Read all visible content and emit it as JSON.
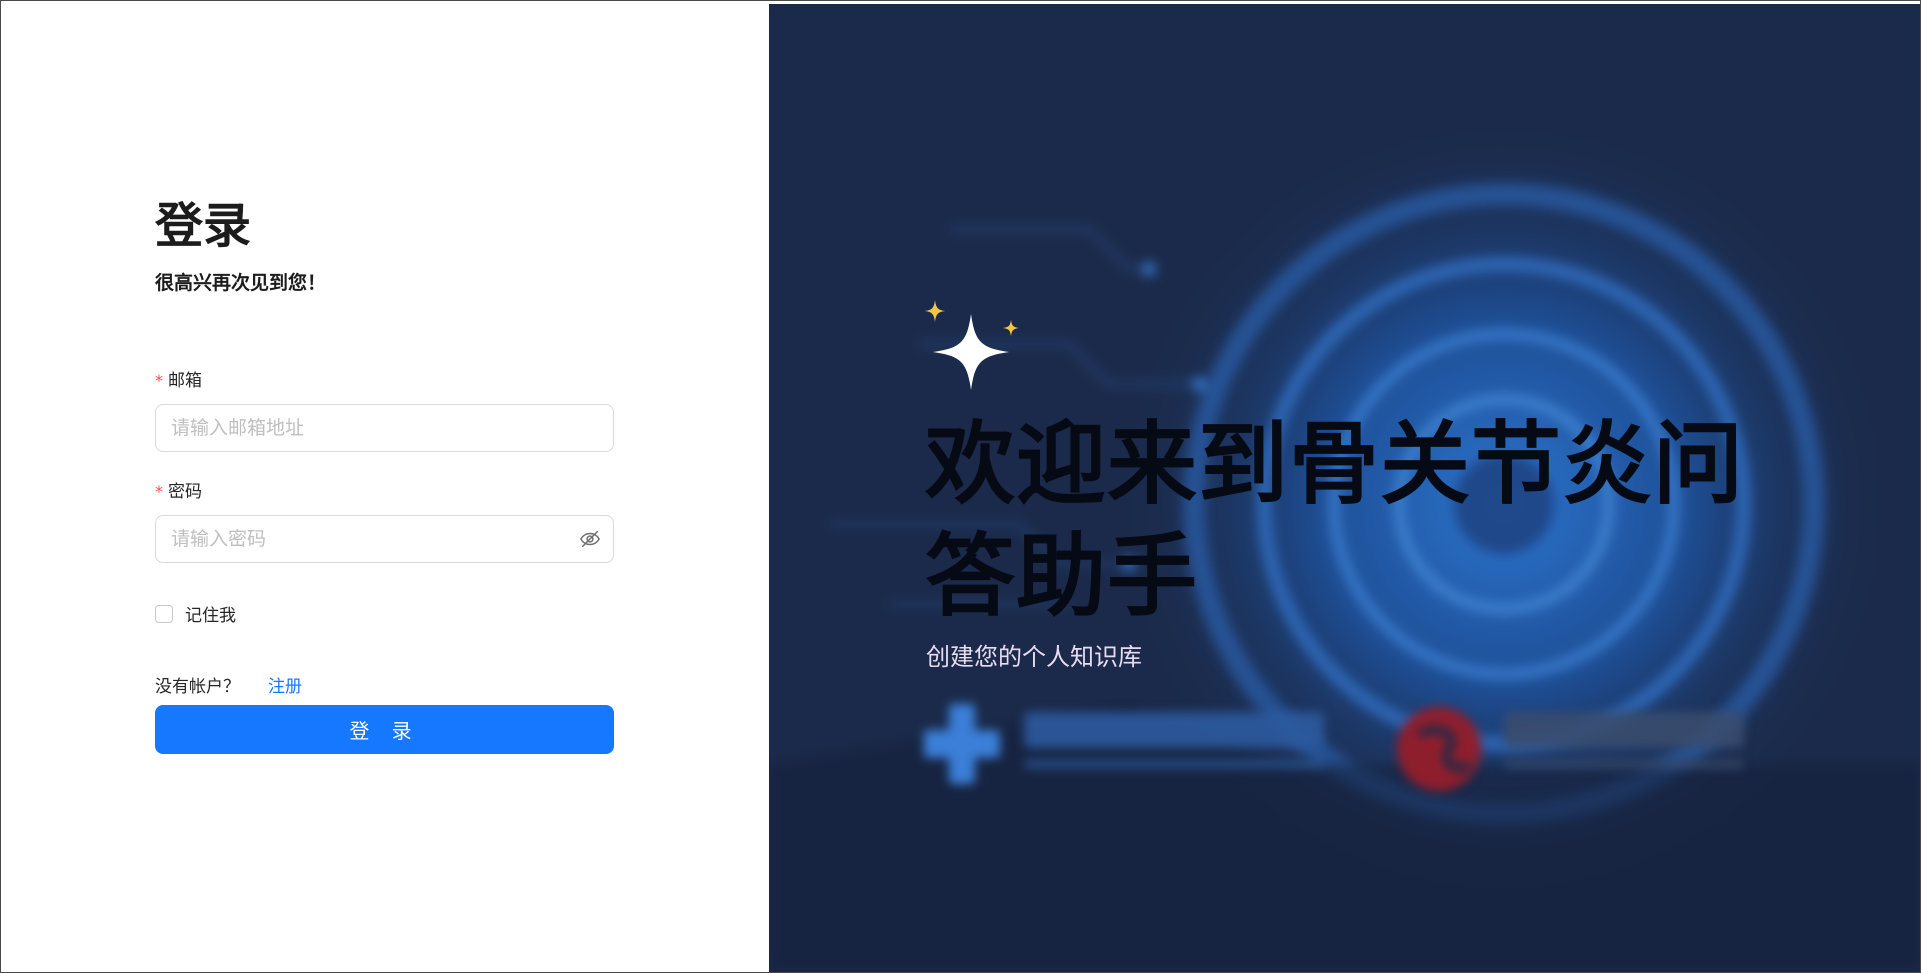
{
  "login": {
    "title": "登录",
    "subtitle": "很高兴再次见到您！",
    "email": {
      "required_mark": "*",
      "label": "邮箱",
      "placeholder": "请输入邮箱地址",
      "value": ""
    },
    "password": {
      "required_mark": "*",
      "label": "密码",
      "placeholder": "请输入密码",
      "value": "",
      "toggle_icon": "eye-invisible-icon"
    },
    "remember_label": "记住我",
    "no_account_text": "没有帐户？",
    "register_link": "注册",
    "submit_label": "登 录"
  },
  "hero": {
    "icon": "sparkle-icon",
    "title": "欢迎来到骨关节炎问答助手",
    "subtitle": "创建您的个人知识库"
  },
  "colors": {
    "primary": "#1677ff",
    "required": "#ff4d4f",
    "hero_bg": "#1b2a4a",
    "sparkle_accent": "#f5c542"
  }
}
